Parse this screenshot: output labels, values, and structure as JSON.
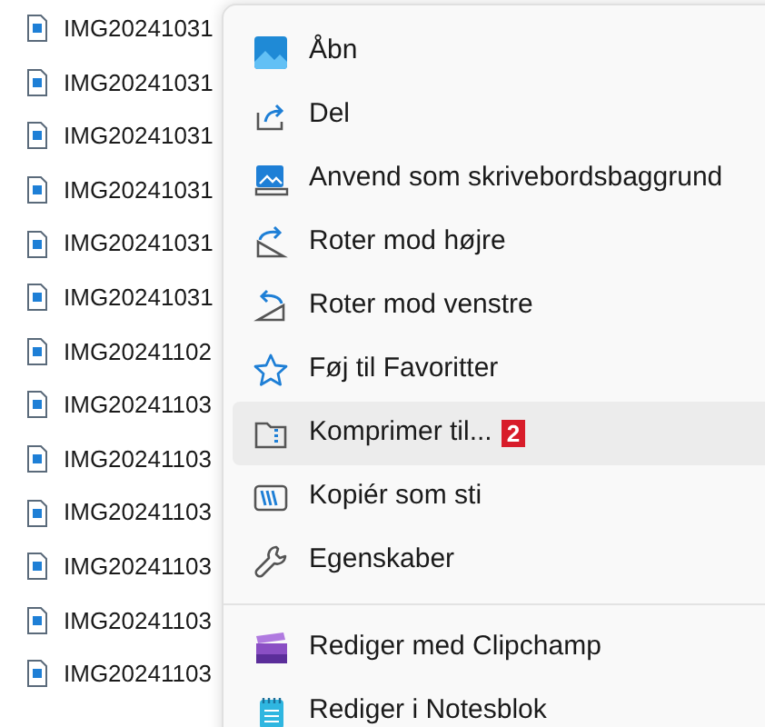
{
  "files": [
    {
      "name": "IMG20241031"
    },
    {
      "name": "IMG20241031"
    },
    {
      "name": "IMG20241031"
    },
    {
      "name": "IMG20241031"
    },
    {
      "name": "IMG20241031"
    },
    {
      "name": "IMG20241031"
    },
    {
      "name": "IMG20241102"
    },
    {
      "name": "IMG20241103"
    },
    {
      "name": "IMG20241103"
    },
    {
      "name": "IMG20241103"
    },
    {
      "name": "IMG20241103"
    },
    {
      "name": "IMG20241103"
    },
    {
      "name": "IMG20241103"
    }
  ],
  "context_menu": {
    "groups": [
      [
        {
          "label": "Åbn",
          "selected": false
        },
        {
          "label": "Del",
          "selected": false
        },
        {
          "label": "Anvend som skrivebordsbaggrund",
          "selected": false
        },
        {
          "label": "Roter mod højre",
          "selected": false
        },
        {
          "label": "Roter mod venstre",
          "selected": false
        },
        {
          "label": "Føj til Favoritter",
          "selected": false
        },
        {
          "label": "Komprimer til...",
          "selected": true,
          "badge": "2"
        },
        {
          "label": "Kopiér som sti",
          "selected": false
        },
        {
          "label": "Egenskaber",
          "selected": false
        }
      ],
      [
        {
          "label": "Rediger med Clipchamp",
          "selected": false
        },
        {
          "label": "Rediger i Notesblok",
          "selected": false
        }
      ]
    ]
  }
}
